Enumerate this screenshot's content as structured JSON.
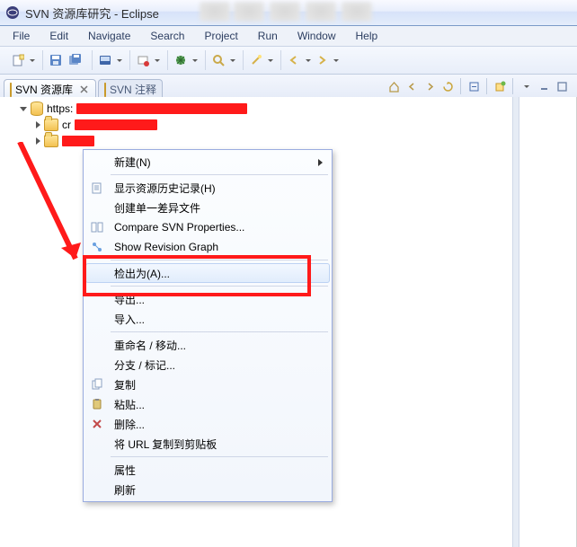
{
  "title": "SVN 资源库研究 - Eclipse",
  "titlebar_blur_positions": [
    220,
    258,
    300,
    340,
    380
  ],
  "menu": [
    "File",
    "Edit",
    "Navigate",
    "Search",
    "Project",
    "Run",
    "Window",
    "Help"
  ],
  "view_tabs": {
    "active": {
      "label": "SVN 资源库"
    },
    "inactive": {
      "label": "SVN 注释"
    }
  },
  "tree": {
    "root_prefix": "https:",
    "child1_prefix": "cr",
    "child2_prefix": ""
  },
  "context_menu": {
    "new": "新建(N)",
    "history": "显示资源历史记录(H)",
    "create_patch": "创建单一差异文件",
    "compare_props": "Compare SVN Properties...",
    "rev_graph": "Show Revision Graph",
    "checkout_as": "检出为(A)...",
    "export": "导出...",
    "import": "导入...",
    "rename_move": "重命名 / 移动...",
    "branch_tag": "分支 / 标记...",
    "copy": "复制",
    "paste": "粘贴...",
    "delete": "删除...",
    "copy_url": "将 URL 复制到剪贴板",
    "properties": "属性",
    "refresh": "刷新"
  }
}
